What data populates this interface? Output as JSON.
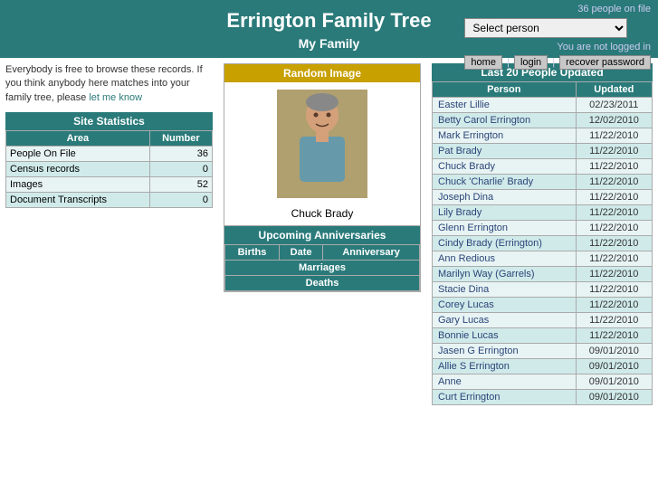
{
  "header": {
    "title": "Errington Family Tree",
    "subtitle": "My Family",
    "people_count": "36 people on file",
    "select_person_label": "Select person",
    "not_logged_in": "You are not logged in",
    "nav": {
      "home": "home",
      "login": "login",
      "recover": "recover password",
      "sep": "|"
    }
  },
  "left": {
    "browse_text_1": "Everybody is free to browse these records. If you think anybody here matches into your family tree, please ",
    "browse_link": "let me know",
    "site_stats_title": "Site Statistics",
    "stats_headers": [
      "Area",
      "Number"
    ],
    "stats_rows": [
      [
        "People On File",
        "36"
      ],
      [
        "Census records",
        "0"
      ],
      [
        "Images",
        "52"
      ],
      [
        "Document Transcripts",
        "0"
      ]
    ]
  },
  "middle": {
    "random_image_title": "Random Image",
    "photo_caption": "Chuck Brady",
    "anniversaries_title": "Upcoming Anniversaries",
    "ann_headers": [
      "Births",
      "Date",
      "Anniversary"
    ],
    "ann_sections": [
      "Births",
      "Marriages",
      "Deaths"
    ]
  },
  "right": {
    "last20_title": "Last 20 People Updated",
    "col_person": "Person",
    "col_updated": "Updated",
    "rows": [
      [
        "Easter Lillie",
        "02/23/2011"
      ],
      [
        "Betty Carol Errington",
        "12/02/2010"
      ],
      [
        "Mark Errington",
        "11/22/2010"
      ],
      [
        "Pat Brady",
        "11/22/2010"
      ],
      [
        "Chuck Brady",
        "11/22/2010"
      ],
      [
        "Chuck 'Charlie' Brady",
        "11/22/2010"
      ],
      [
        "Joseph Dina",
        "11/22/2010"
      ],
      [
        "Lily Brady",
        "11/22/2010"
      ],
      [
        "Glenn Errington",
        "11/22/2010"
      ],
      [
        "Cindy Brady (Errington)",
        "11/22/2010"
      ],
      [
        "Ann Redious",
        "11/22/2010"
      ],
      [
        "Marilyn Way (Garrels)",
        "11/22/2010"
      ],
      [
        "Stacie Dina",
        "11/22/2010"
      ],
      [
        "Corey Lucas",
        "11/22/2010"
      ],
      [
        "Gary Lucas",
        "11/22/2010"
      ],
      [
        "Bonnie Lucas",
        "11/22/2010"
      ],
      [
        "Jasen G Errington",
        "09/01/2010"
      ],
      [
        "Allie S Errington",
        "09/01/2010"
      ],
      [
        "Anne",
        "09/01/2010"
      ],
      [
        "Curt Errington",
        "09/01/2010"
      ]
    ]
  }
}
